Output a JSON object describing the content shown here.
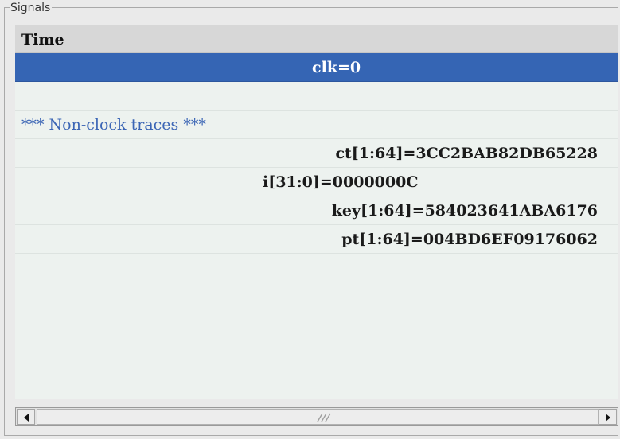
{
  "panel": {
    "legend": "Signals"
  },
  "table": {
    "header": "Time",
    "rows": [
      {
        "text": "clk=0"
      },
      {
        "text": ""
      },
      {
        "text": "*** Non-clock traces ***"
      },
      {
        "text": "ct[1:64]=3CC2BAB82DB65228"
      },
      {
        "text": "i[31:0]=0000000C"
      },
      {
        "text": "key[1:64]=584023641ABA6176"
      },
      {
        "text": "pt[1:64]=004BD6EF09176062"
      }
    ]
  },
  "scrollbar": {
    "left_icon": "arrow-left-icon",
    "right_icon": "arrow-right-icon",
    "grip_icon": "grip-icon"
  },
  "colors": {
    "selection": "#3565b4",
    "comment_text": "#3b65b5",
    "pane_background": "#edf2ef"
  }
}
